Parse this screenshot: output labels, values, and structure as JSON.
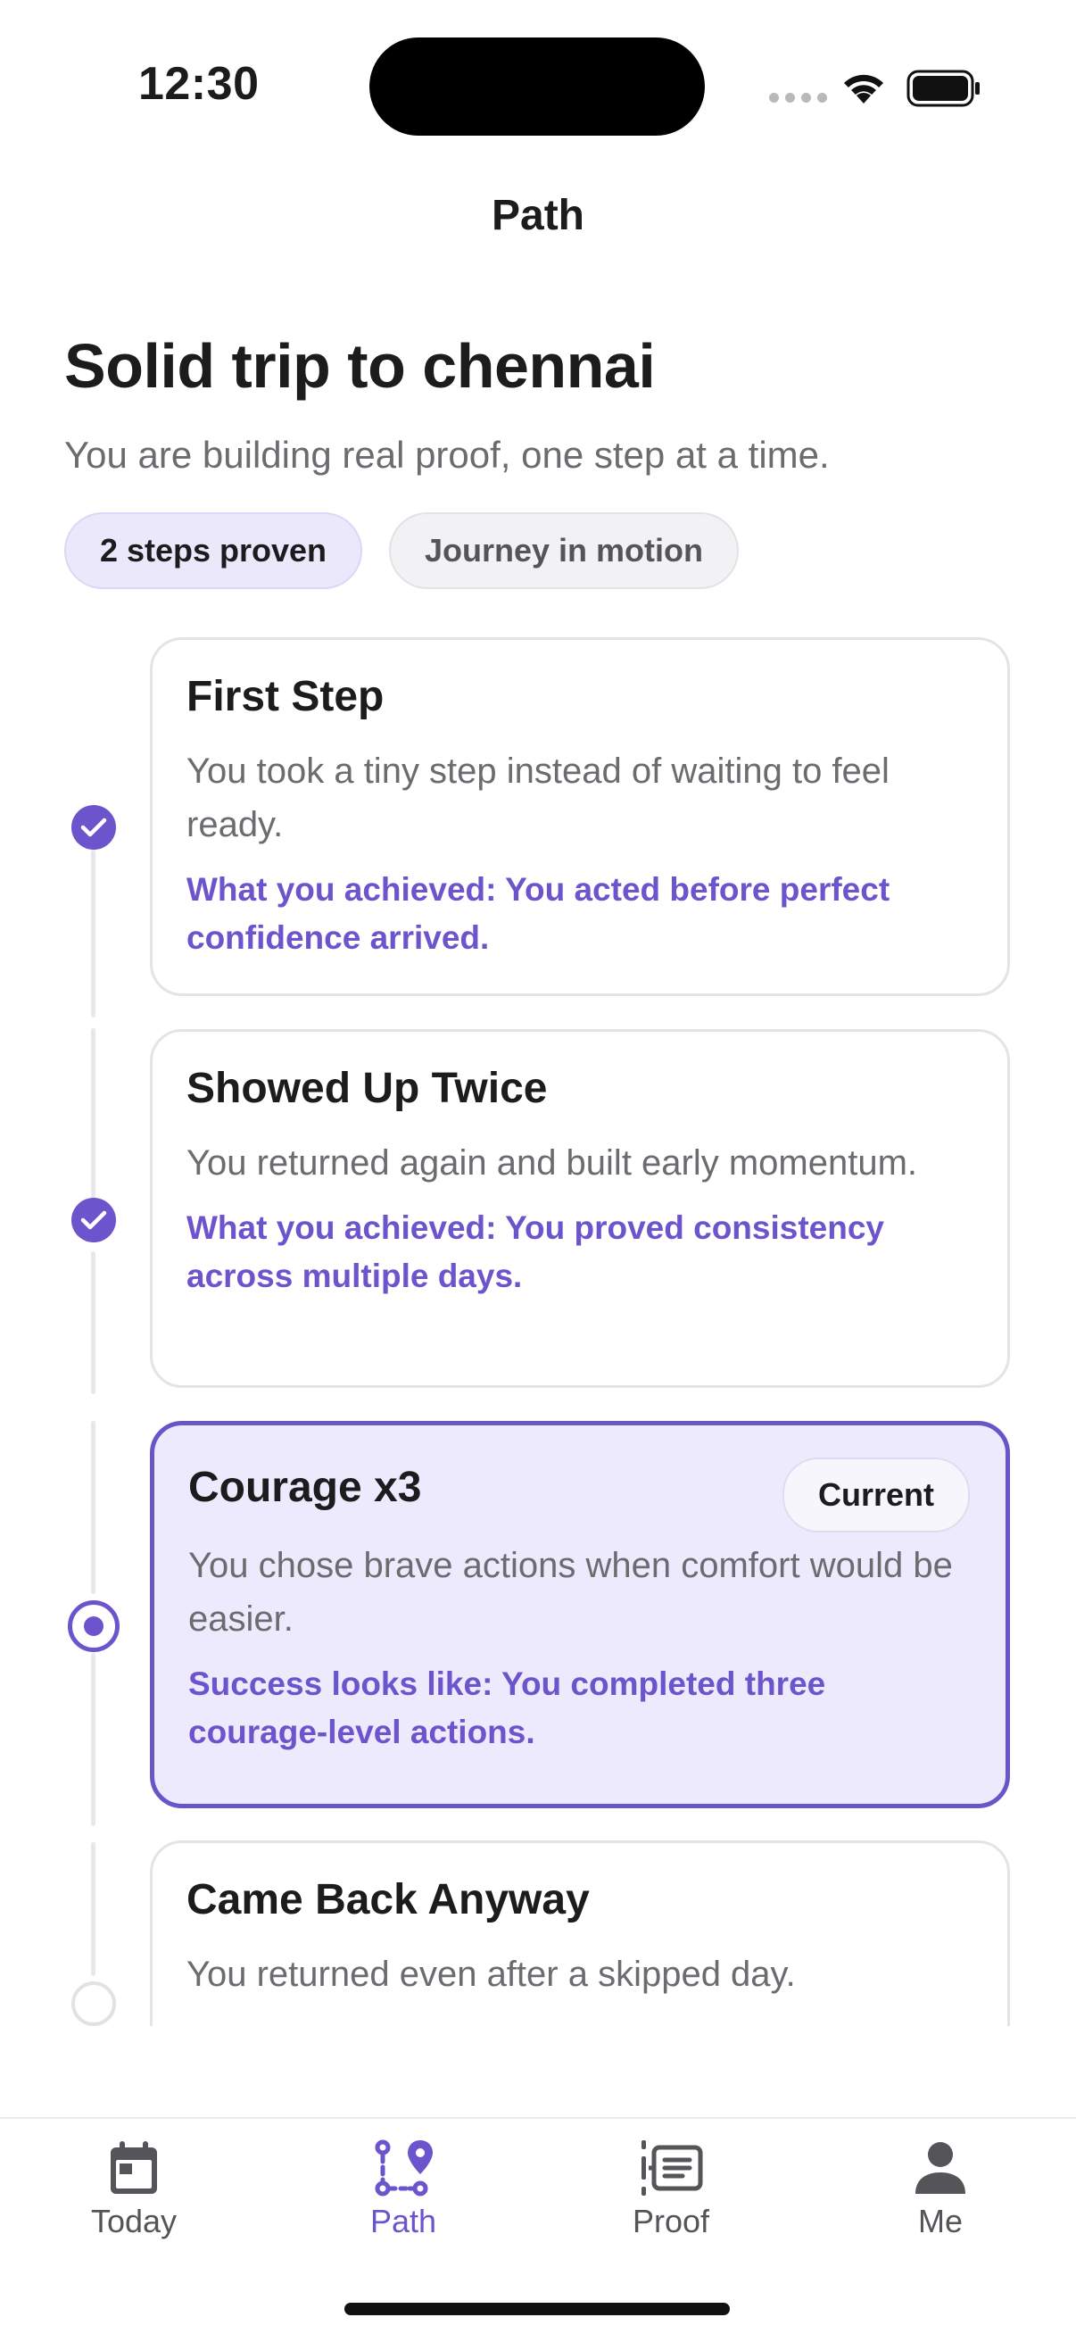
{
  "status_bar": {
    "time": "12:30"
  },
  "nav": {
    "title": "Path"
  },
  "journey": {
    "title": "Solid trip to chennai",
    "subtitle": "You are building real proof, one step at a time.",
    "chips": {
      "steps": "2 steps proven",
      "status": "Journey in motion"
    }
  },
  "steps": [
    {
      "title": "First Step",
      "description": "You took a tiny step instead of waiting to feel ready.",
      "achievement": "What you achieved: You acted before perfect confidence arrived.",
      "state": "done"
    },
    {
      "title": "Showed Up Twice",
      "description": "You returned again and built early momentum.",
      "achievement": "What you achieved: You proved consistency across multiple days.",
      "state": "done"
    },
    {
      "title": "Courage x3",
      "badge": "Current",
      "description": "You chose brave actions when comfort would be easier.",
      "achievement": "Success looks like: You completed three courage-level actions.",
      "state": "current"
    },
    {
      "title": "Came Back Anyway",
      "description": "You returned even after a skipped day.",
      "state": "pending"
    }
  ],
  "tabs": [
    {
      "label": "Today",
      "icon": "calendar-icon",
      "active": false
    },
    {
      "label": "Path",
      "icon": "route-icon",
      "active": true
    },
    {
      "label": "Proof",
      "icon": "list-icon",
      "active": false
    },
    {
      "label": "Me",
      "icon": "person-icon",
      "active": false
    }
  ],
  "colors": {
    "accent": "#6C54CC",
    "current_card_bg": "#ECEAFC",
    "text": "#1C1C1E",
    "muted": "#6B6B70"
  }
}
